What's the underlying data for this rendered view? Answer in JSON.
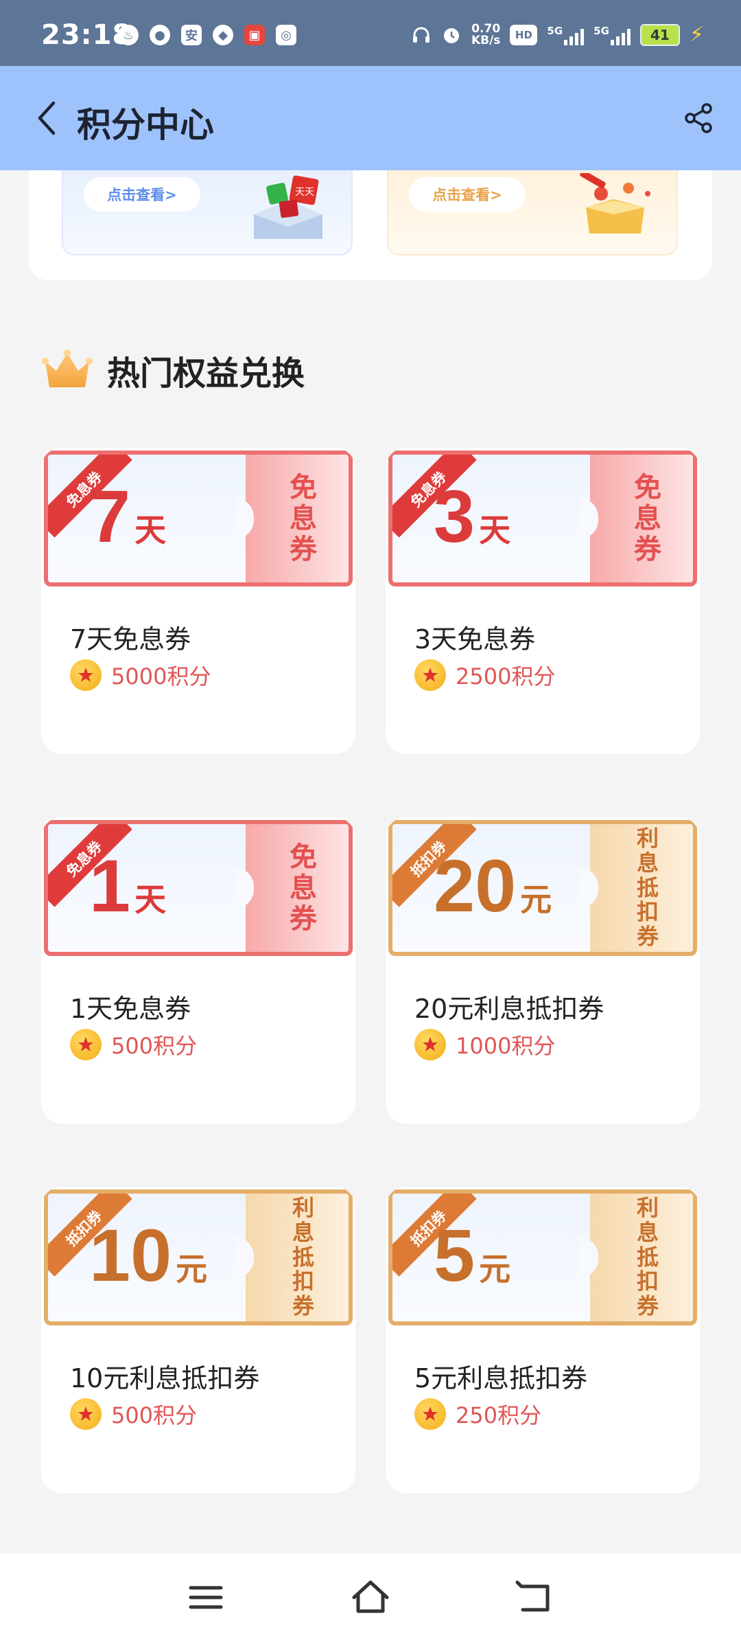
{
  "status_bar": {
    "time": "23:18",
    "net_speed_value": "0.70",
    "net_speed_unit": "KB/s",
    "hd_label": "HD",
    "signal1_label": "5G",
    "signal2_label": "5G",
    "battery": "41",
    "left_icons": [
      "flame",
      "chat",
      "安",
      "qq",
      "tmall",
      "app"
    ]
  },
  "header": {
    "title": "积分中心",
    "back_icon": "chevron-left-icon",
    "share_icon": "share-icon"
  },
  "banner": {
    "left_button": "点击查看>",
    "right_button": "点击查看>",
    "left_badge": "天天"
  },
  "section": {
    "title": "热门权益兑换",
    "icon": "crown-icon"
  },
  "products": [
    {
      "theme": "red",
      "ribbon": "免息券",
      "big_number": "7",
      "unit": "天",
      "stub": "免息券",
      "name": "7天免息券",
      "price": "5000积分"
    },
    {
      "theme": "red",
      "ribbon": "免息券",
      "big_number": "3",
      "unit": "天",
      "stub": "免息券",
      "name": "3天免息券",
      "price": "2500积分"
    },
    {
      "theme": "red",
      "ribbon": "免息券",
      "big_number": "1",
      "unit": "天",
      "stub": "免息券",
      "name": "1天免息券",
      "price": "500积分"
    },
    {
      "theme": "orange",
      "ribbon": "抵扣券",
      "big_number": "20",
      "unit": "元",
      "stub": "利息抵扣券",
      "name": "20元利息抵扣券",
      "price": "1000积分"
    },
    {
      "theme": "orange",
      "ribbon": "抵扣券",
      "big_number": "10",
      "unit": "元",
      "stub": "利息抵扣券",
      "name": "10元利息抵扣券",
      "price": "500积分"
    },
    {
      "theme": "orange",
      "ribbon": "抵扣券",
      "big_number": "5",
      "unit": "元",
      "stub": "利息抵扣券",
      "name": "5元利息抵扣券",
      "price": "250积分"
    }
  ],
  "colors": {
    "status_bar": "#5d7596",
    "header": "#9ec3fc",
    "price": "#e05656",
    "coupon_red": "#ee6f6f",
    "coupon_orange": "#e4ad6a"
  },
  "nav": {
    "menu_icon": "menu-icon",
    "home_icon": "home-icon",
    "back_icon": "back-icon"
  }
}
